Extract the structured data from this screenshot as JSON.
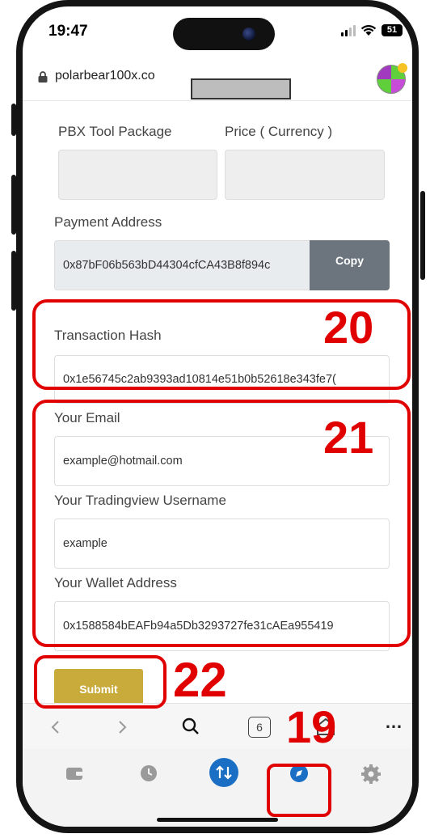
{
  "status_bar": {
    "time": "19:47",
    "battery": "51"
  },
  "browser": {
    "url": "polarbear100x.co"
  },
  "form": {
    "tool_package_label": "PBX Tool Package",
    "price_label": "Price ( Currency )",
    "payment_address_label": "Payment Address",
    "payment_address_value": "0x87bF06b563bD44304cfCA43B8f894c",
    "copy_label": "Copy",
    "tx_hash_label": "Transaction Hash",
    "tx_hash_value": "0x1e56745c2ab9393ad10814e51b0b52618e343fe7(",
    "email_label": "Your Email",
    "email_value": "example@hotmail.com",
    "tv_username_label": "Your Tradingview Username",
    "tv_username_value": "example",
    "wallet_label": "Your Wallet Address",
    "wallet_value": "0x1588584bEAFb94a5Db3293727fe31cAEa955419",
    "submit_label": "Submit"
  },
  "toolbar": {
    "tab_count": "6",
    "more": "…"
  },
  "annotations": {
    "a20": "20",
    "a21": "21",
    "a22": "22",
    "a19": "19"
  },
  "colors": {
    "annotation": "#e00000",
    "submit": "#c9ab3c",
    "copy": "#6c757d",
    "nav_active": "#1a6fc4"
  },
  "icons": [
    "lock-icon",
    "wallet-icon",
    "clock-icon",
    "swap-icon",
    "compass-icon",
    "gear-icon",
    "search-icon",
    "home-icon",
    "back-icon",
    "forward-icon"
  ]
}
